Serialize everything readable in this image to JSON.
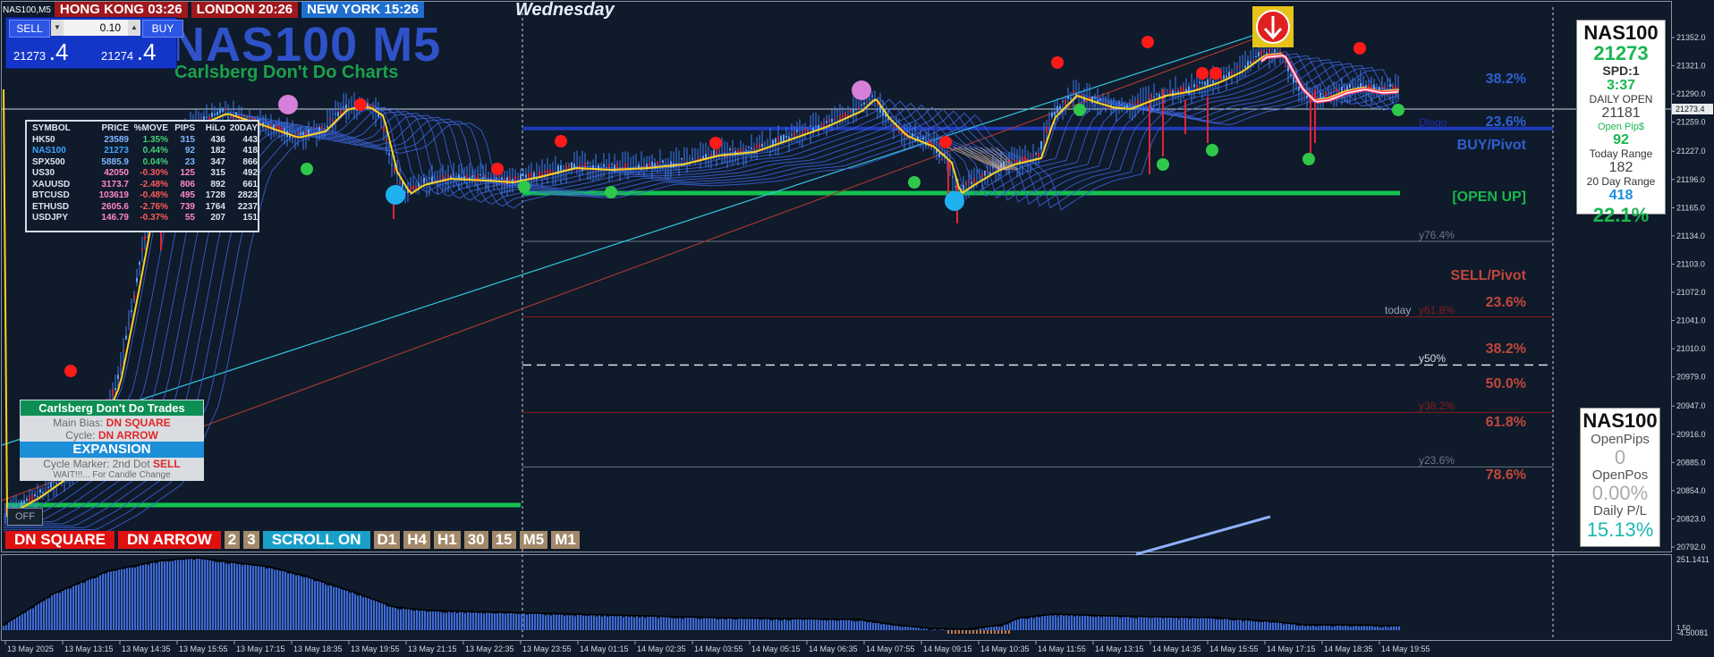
{
  "symbol_label": "NAS100,M5",
  "clocks": [
    {
      "label": "HONG KONG 03:26",
      "cls": "hk"
    },
    {
      "label": "LONDON  20:26",
      "cls": "ld"
    },
    {
      "label": "NEW YORK  15:26",
      "cls": "ny"
    }
  ],
  "day_name": "Wednesday",
  "trade_panel": {
    "sell_label": "SELL",
    "buy_label": "BUY",
    "lot_value": "0.10",
    "sell_price_small": "21273",
    "sell_price_big": ".4",
    "buy_price_small": "21274",
    "buy_price_big": ".4"
  },
  "big_title": "NAS100 M5",
  "big_subtitle": "Carlsberg Don't Do Charts",
  "quote_table": {
    "headers": [
      "SYMBOL",
      "PRICE",
      "%MOVE",
      "PIPS",
      "HiLo",
      "20DAY"
    ],
    "rows": [
      {
        "symbol": "HK50",
        "price": "23589",
        "move": "1.35%",
        "dir": "up",
        "pips": "315",
        "hilo": "436",
        "d20": "443",
        "pcolor": "#7fb6ff"
      },
      {
        "symbol": "NAS100",
        "price": "21273",
        "move": "0.44%",
        "dir": "up",
        "pips": "92",
        "hilo": "182",
        "d20": "418",
        "pcolor": "#3da4ff"
      },
      {
        "symbol": "SPX500",
        "price": "5885.9",
        "move": "0.04%",
        "dir": "up",
        "pips": "23",
        "hilo": "347",
        "d20": "866",
        "pcolor": "#7fb6ff"
      },
      {
        "symbol": "US30",
        "price": "42050",
        "move": "-0.30%",
        "dir": "dn",
        "pips": "125",
        "hilo": "315",
        "d20": "492",
        "pcolor": "#ff88c8"
      },
      {
        "symbol": "XAUUSD",
        "price": "3173.7",
        "move": "-2.48%",
        "dir": "dn",
        "pips": "806",
        "hilo": "892",
        "d20": "661",
        "pcolor": "#ff88c8"
      },
      {
        "symbol": "BTCUSD",
        "price": "103619",
        "move": "-0.48%",
        "dir": "dn",
        "pips": "495",
        "hilo": "1728",
        "d20": "2823",
        "pcolor": "#ff88c8"
      },
      {
        "symbol": "ETHUSD",
        "price": "2605.6",
        "move": "-2.76%",
        "dir": "dn",
        "pips": "739",
        "hilo": "1764",
        "d20": "2237",
        "pcolor": "#ff88c8"
      },
      {
        "symbol": "USDJPY",
        "price": "146.79",
        "move": "-0.37%",
        "dir": "dn",
        "pips": "55",
        "hilo": "207",
        "d20": "151",
        "pcolor": "#ff88c8"
      }
    ]
  },
  "trades_box": {
    "title": "Carlsberg Don't Do Trades",
    "bias_label": "Main Bias:",
    "bias_value": "DN SQUARE",
    "cycle_label": "Cycle:",
    "cycle_value": "DN ARROW",
    "expansion": "EXPANSION",
    "marker_label": "Cycle Marker: 2nd Dot",
    "marker_value": "SELL",
    "wait_text": "WAIT!!!... For Candle Change"
  },
  "off_label": "OFF",
  "button_bar": [
    {
      "label": "DN SQUARE",
      "style": "red wide"
    },
    {
      "label": "DN ARROW",
      "style": "red wide"
    },
    {
      "label": "2",
      "style": "tan"
    },
    {
      "label": "3",
      "style": "tan"
    },
    {
      "label": "SCROLL ON",
      "style": "teal wide"
    },
    {
      "label": "D1",
      "style": "tan"
    },
    {
      "label": "H4",
      "style": "tan"
    },
    {
      "label": "H1",
      "style": "tan"
    },
    {
      "label": "30",
      "style": "tan"
    },
    {
      "label": "15",
      "style": "tan"
    },
    {
      "label": "M5",
      "style": "tan"
    },
    {
      "label": "M1",
      "style": "tan"
    }
  ],
  "fib_labels": [
    {
      "text": "38.2%",
      "price": 21305,
      "color": "#2f5fd0"
    },
    {
      "text": "23.6%",
      "price": 21258,
      "color": "#2f5fd0"
    },
    {
      "text": "BUY/Pivot",
      "price": 21232,
      "color": "#2f5fd0"
    },
    {
      "text": "[OPEN UP]",
      "price": 21175,
      "color": "#19b74f"
    },
    {
      "text": "SELL/Pivot",
      "price": 21089,
      "color": "#c0473b"
    },
    {
      "text": "23.6%",
      "price": 21059,
      "color": "#c0473b"
    },
    {
      "text": "38.2%",
      "price": 21008,
      "color": "#c0473b"
    },
    {
      "text": "50.0%",
      "price": 20970,
      "color": "#c0473b"
    },
    {
      "text": "61.8%",
      "price": 20928,
      "color": "#c0473b"
    },
    {
      "text": "78.6%",
      "price": 20870,
      "color": "#c0473b"
    }
  ],
  "level_labels": [
    {
      "text": "y76.4%",
      "price": 21128,
      "color": "#6b7685"
    },
    {
      "text": "today",
      "price": 21045,
      "color": "#9aa6b2"
    },
    {
      "text": "y61.8%",
      "price": 21045,
      "color": "#8a1c1c"
    },
    {
      "text": "y50%",
      "price": 20992,
      "color": "#d7dde5"
    },
    {
      "text": "y38.2%",
      "price": 20940,
      "color": "#8a1c1c"
    },
    {
      "text": "y23.6%",
      "price": 20880,
      "color": "#6b7685"
    },
    {
      "text": "Dlogo",
      "price": 21252,
      "color": "#1a2fa8"
    }
  ],
  "right_panel": {
    "symbol": "NAS100",
    "price": "21273",
    "spread": "SPD:1",
    "timer": "3:37",
    "daily_open_label": "DAILY OPEN",
    "daily_open": "21181",
    "open_pips_label": "Open Pip$",
    "open_pips": "92",
    "today_range_label": "Today Range",
    "today_range": "182",
    "day20_label": "20 Day Range",
    "day20_range": "418",
    "pct": "22.1%"
  },
  "right_panel2": {
    "symbol": "NAS100",
    "open_pips_label": "OpenPips",
    "open_pips": "0",
    "open_pos_label": "OpenPos",
    "open_pos": "0.00%",
    "daily_pl_label": "Daily P/L",
    "daily_pl": "15.13%"
  },
  "price_axis": {
    "ticks": [
      "21352.0",
      "21321.0",
      "21290.0",
      "21259.0",
      "21227.0",
      "21196.0",
      "21165.0",
      "21134.0",
      "21103.0",
      "21072.0",
      "21041.0",
      "21010.0",
      "20979.0",
      "20947.0",
      "20916.0",
      "20885.0",
      "20854.0",
      "20823.0",
      "20792.0"
    ],
    "current": "21273.4",
    "osc_top": "251.1411",
    "osc_bottom": "-4.50081",
    "osc_mid": "1.50"
  },
  "time_axis": [
    "13 May 2025",
    "13 May 13:15",
    "13 May 14:35",
    "13 May 15:55",
    "13 May 17:15",
    "13 May 18:35",
    "13 May 19:55",
    "13 May 21:15",
    "13 May 22:35",
    "13 May 23:55",
    "14 May 01:15",
    "14 May 02:35",
    "14 May 03:55",
    "14 May 05:15",
    "14 May 06:35",
    "14 May 07:55",
    "14 May 09:15",
    "14 May 10:35",
    "14 May 11:55",
    "14 May 13:15",
    "14 May 14:35",
    "14 May 15:55",
    "14 May 17:15",
    "14 May 18:35",
    "14 May 19:55"
  ],
  "colors": {
    "background": "#0f1a2a",
    "ribbon": "#3b63d9",
    "open_line": "#12c24e",
    "daily_line": "#1f3bb8",
    "trendline_cyan": "#35c6e0",
    "trendline_red": "#a0392e",
    "sell_dot": "#ff1a1a",
    "buy_dot": "#2ec84a"
  }
}
